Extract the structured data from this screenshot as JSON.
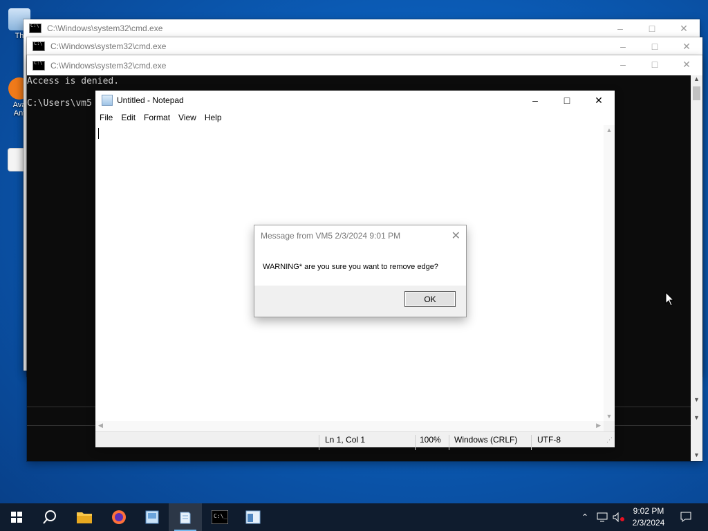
{
  "desktop": {
    "icons": [
      {
        "label": "Th",
        "icon": "recycle-bin-icon"
      },
      {
        "label": "Ava\nAnt",
        "icon": "avast-antivirus-icon"
      },
      {
        "label": "",
        "icon": "document-icon"
      }
    ]
  },
  "cmd_windows": [
    {
      "title": "C:\\Windows\\system32\\cmd.exe"
    },
    {
      "title": "C:\\Windows\\system32\\cmd.exe"
    },
    {
      "title": "C:\\Windows\\system32\\cmd.exe"
    }
  ],
  "console": {
    "line1": "Access is denied.",
    "line2": "C:\\Users\\vm5"
  },
  "notepad": {
    "title": "Untitled - Notepad",
    "menu": [
      "File",
      "Edit",
      "Format",
      "View",
      "Help"
    ],
    "status": {
      "position": "Ln 1, Col 1",
      "zoom": "100%",
      "line_endings": "Windows (CRLF)",
      "encoding": "UTF-8"
    }
  },
  "dialog": {
    "title": "Message from VM5 2/3/2024 9:01 PM",
    "message": "WARNING* are you sure you want to remove edge?",
    "ok_label": "OK"
  },
  "taskbar": {
    "apps": [
      "start-icon",
      "search-icon",
      "file-explorer-icon",
      "firefox-icon",
      "image-viewer-icon",
      "notepad-icon",
      "cmd-icon",
      "window-app-icon"
    ],
    "active_app": "notepad-icon",
    "clock_time": "9:02 PM",
    "clock_date": "2/3/2024"
  },
  "colors": {
    "console_bg": "#0c0c0c",
    "taskbar_bg": "#0f1c2e",
    "desktop_bg": "#0b5bb5"
  }
}
